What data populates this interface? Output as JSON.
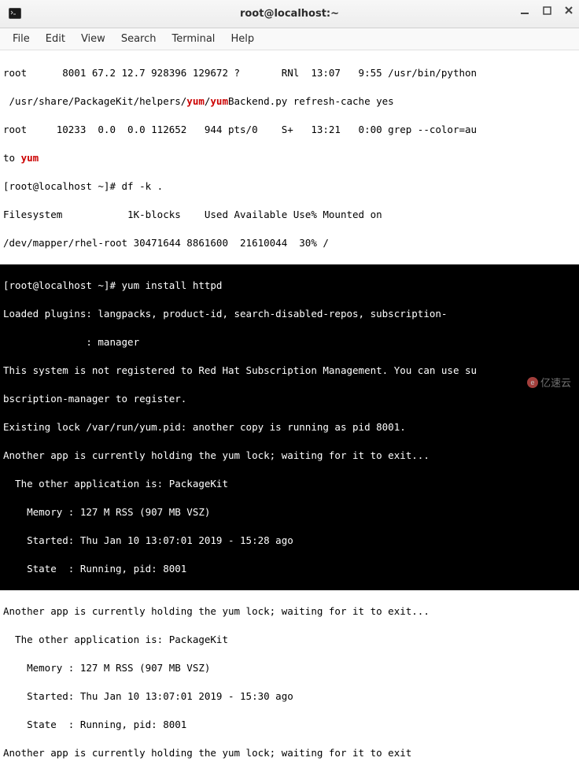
{
  "window": {
    "title": "root@localhost:~"
  },
  "menubar": {
    "file": "File",
    "edit": "Edit",
    "view": "View",
    "search": "Search",
    "terminal": "Terminal",
    "help": "Help"
  },
  "term": {
    "ps_line1_a": "root      8001 67.2 12.7 928396 129672 ?       RNl  13:07   9:55 /usr/bin/python",
    "ps_line1_b_a": " /usr/share/PackageKit/helpers/",
    "ps_line1_b_yum1": "yum",
    "ps_line1_b_slash": "/",
    "ps_line1_b_yum2": "yum",
    "ps_line1_b_b": "Backend.py refresh-cache yes",
    "ps_line2_a": "root     10233  0.0  0.0 112652   944 pts/0    S+   13:21   0:00 grep --color=au",
    "ps_line2_b_a": "to ",
    "ps_line2_b_yum": "yum",
    "prompt1": "[root@localhost ~]# df -k .",
    "df_hdr": "Filesystem           1K-blocks    Used Available Use% Mounted on",
    "df_row": "/dev/mapper/rhel-root 30471644 8861600  21610044  30% /",
    "prompt2": "[root@localhost ~]# yum install httpd",
    "yum_l1": "Loaded plugins: langpacks, product-id, search-disabled-repos, subscription-",
    "yum_l2": "              : manager",
    "yum_l3": "This system is not registered to Red Hat Subscription Management. You can use su",
    "yum_l4": "bscription-manager to register.",
    "yum_l5": "Existing lock /var/run/yum.pid: another copy is running as pid 8001.",
    "yum_l6": "Another app is currently holding the yum lock; waiting for it to exit...",
    "yum_l7": "  The other application is: PackageKit",
    "yum_l8": "    Memory : 127 M RSS (907 MB VSZ)",
    "yum_l9": "    Started: Thu Jan 10 13:07:01 2019 - 15:28 ago",
    "yum_l10": "    State  : Running, pid: 8001",
    "yum_l11": "Another app is currently holding the yum lock; waiting for it to exit...",
    "yum_l12": "  The other application is: PackageKit",
    "yum_l13": "    Memory : 127 M RSS (907 MB VSZ)",
    "yum_l14": "    Started: Thu Jan 10 13:07:01 2019 - 15:30 ago",
    "yum_l15": "    State  : Running, pid: 8001",
    "yum_l16": "Another app is currently holding the yum lock; waiting for it to exit"
  },
  "watermark": {
    "text": "亿速云"
  }
}
